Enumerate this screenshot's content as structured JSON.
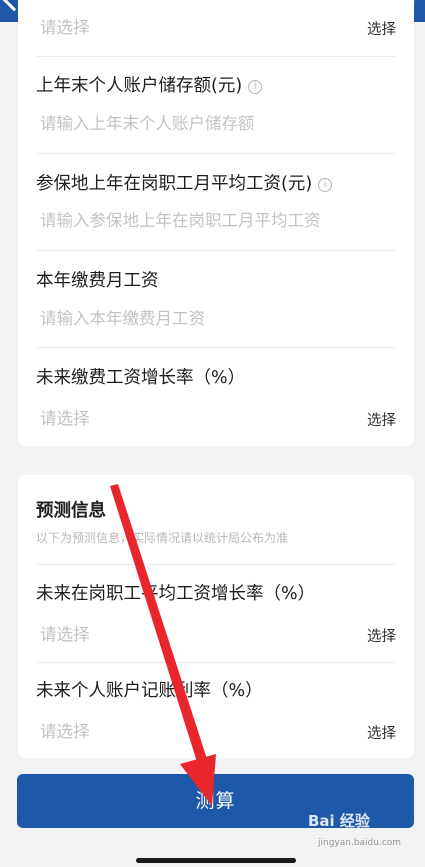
{
  "header": {
    "back_icon": "chevron-left-icon",
    "more_icon": "more-icon",
    "close_icon": "close-circle-icon"
  },
  "form": {
    "row0": {
      "placeholder": "请选择",
      "pick": "选择"
    },
    "row1": {
      "label": "上年末个人账户储存额(元)",
      "placeholder": "请输入上年末个人账户储存额",
      "icon": "info-icon"
    },
    "row2": {
      "label": "参保地上年在岗职工月平均工资(元)",
      "placeholder": "请输入参保地上年在岗职工月平均工资",
      "icon": "info-icon"
    },
    "row3": {
      "label": "本年缴费月工资",
      "placeholder": "请输入本年缴费月工资"
    },
    "row4": {
      "label": "未来缴费工资增长率（%）",
      "placeholder": "请选择",
      "pick": "选择"
    }
  },
  "prediction": {
    "title": "预测信息",
    "subtitle": "以下为预测信息，实际情况请以统计局公布为准",
    "row1": {
      "label": "未来在岗职工平均工资增长率（%）",
      "placeholder": "请选择",
      "pick": "选择"
    },
    "row2": {
      "label": "未来个人账户记账利率（%）",
      "placeholder": "请选择",
      "pick": "选择"
    }
  },
  "actions": {
    "calculate": "测算"
  },
  "watermark": {
    "text": "Bai 经验",
    "sub": "jingyan.baidu.com"
  },
  "colors": {
    "primary": "#1e58a8",
    "background": "#f2f3f5",
    "annotation": "#e8262b"
  }
}
